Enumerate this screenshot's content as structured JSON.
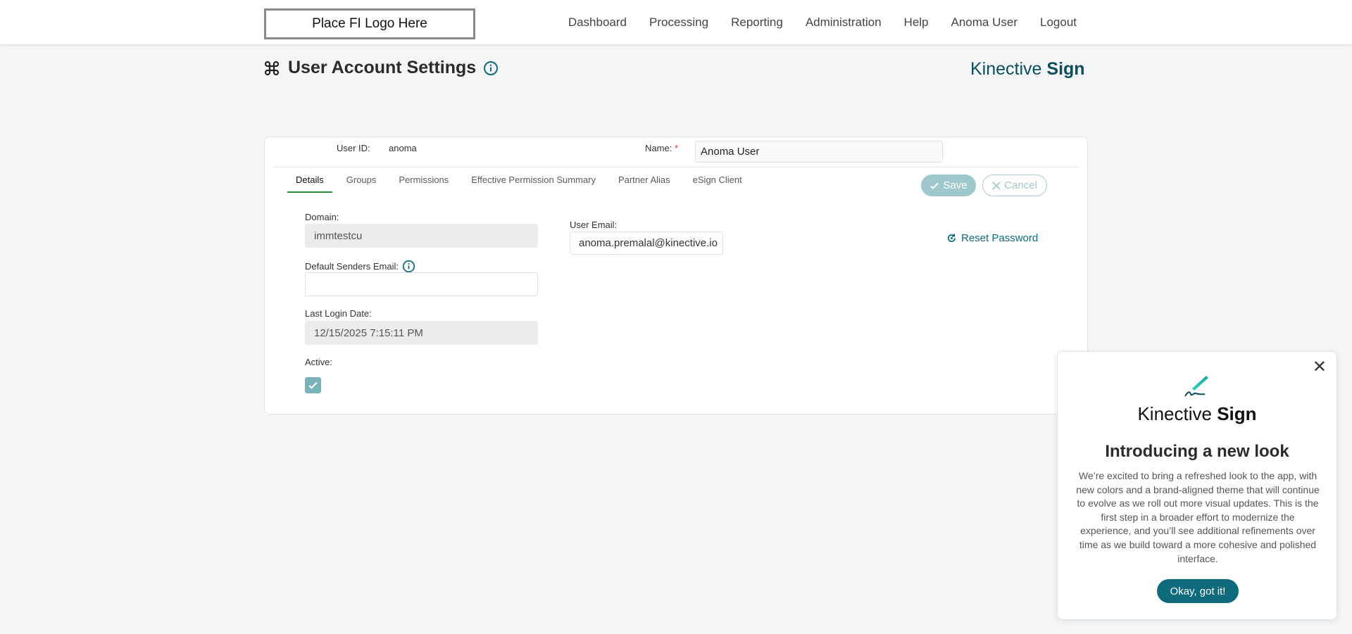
{
  "header": {
    "logo_text": "Place FI Logo Here",
    "nav": [
      "Dashboard",
      "Processing",
      "Reporting",
      "Administration",
      "Help",
      "Anoma User",
      "Logout"
    ]
  },
  "page": {
    "title": "User Account Settings",
    "brand_word1": "Kinective",
    "brand_word2": "Sign"
  },
  "user_header": {
    "user_id_label": "User ID:",
    "user_id_value": "anoma",
    "name_label": "Name:",
    "required_mark": "*",
    "name_value": "Anoma User"
  },
  "tabs": [
    "Details",
    "Groups",
    "Permissions",
    "Effective Permission Summary",
    "Partner Alias",
    "eSign Client"
  ],
  "active_tab": "Details",
  "actions": {
    "save": "Save",
    "cancel": "Cancel"
  },
  "details": {
    "domain_label": "Domain:",
    "domain_value": "immtestcu",
    "default_senders_label": "Default Senders Email:",
    "default_senders_value": "",
    "last_login_label": "Last Login Date:",
    "last_login_value": "12/15/2025 7:15:11 PM",
    "active_label": "Active:",
    "active_checked": true,
    "user_email_label": "User Email:",
    "user_email_value": "anoma.premalal@kinective.io",
    "reset_password": "Reset Password"
  },
  "popup": {
    "brand_word1": "Kinective",
    "brand_word2": "Sign",
    "title": "Introducing a new look",
    "body": "We’re excited to bring a refreshed look to the app, with new colors and a brand-aligned theme that will continue to evolve as we roll out more visual updates. This is the first step in a broader effort to modernize the experience, and you’ll see additional refinements over time as we build toward a more cohesive and polished interface.",
    "button": "Okay, got it!",
    "close": "✕"
  },
  "colors": {
    "accent": "#0d6b7b",
    "active_tab_underline": "#2a8a3a",
    "save_button": "#9fc8cd",
    "checkbox": "#7ab2bb",
    "required": "#dd3333"
  }
}
